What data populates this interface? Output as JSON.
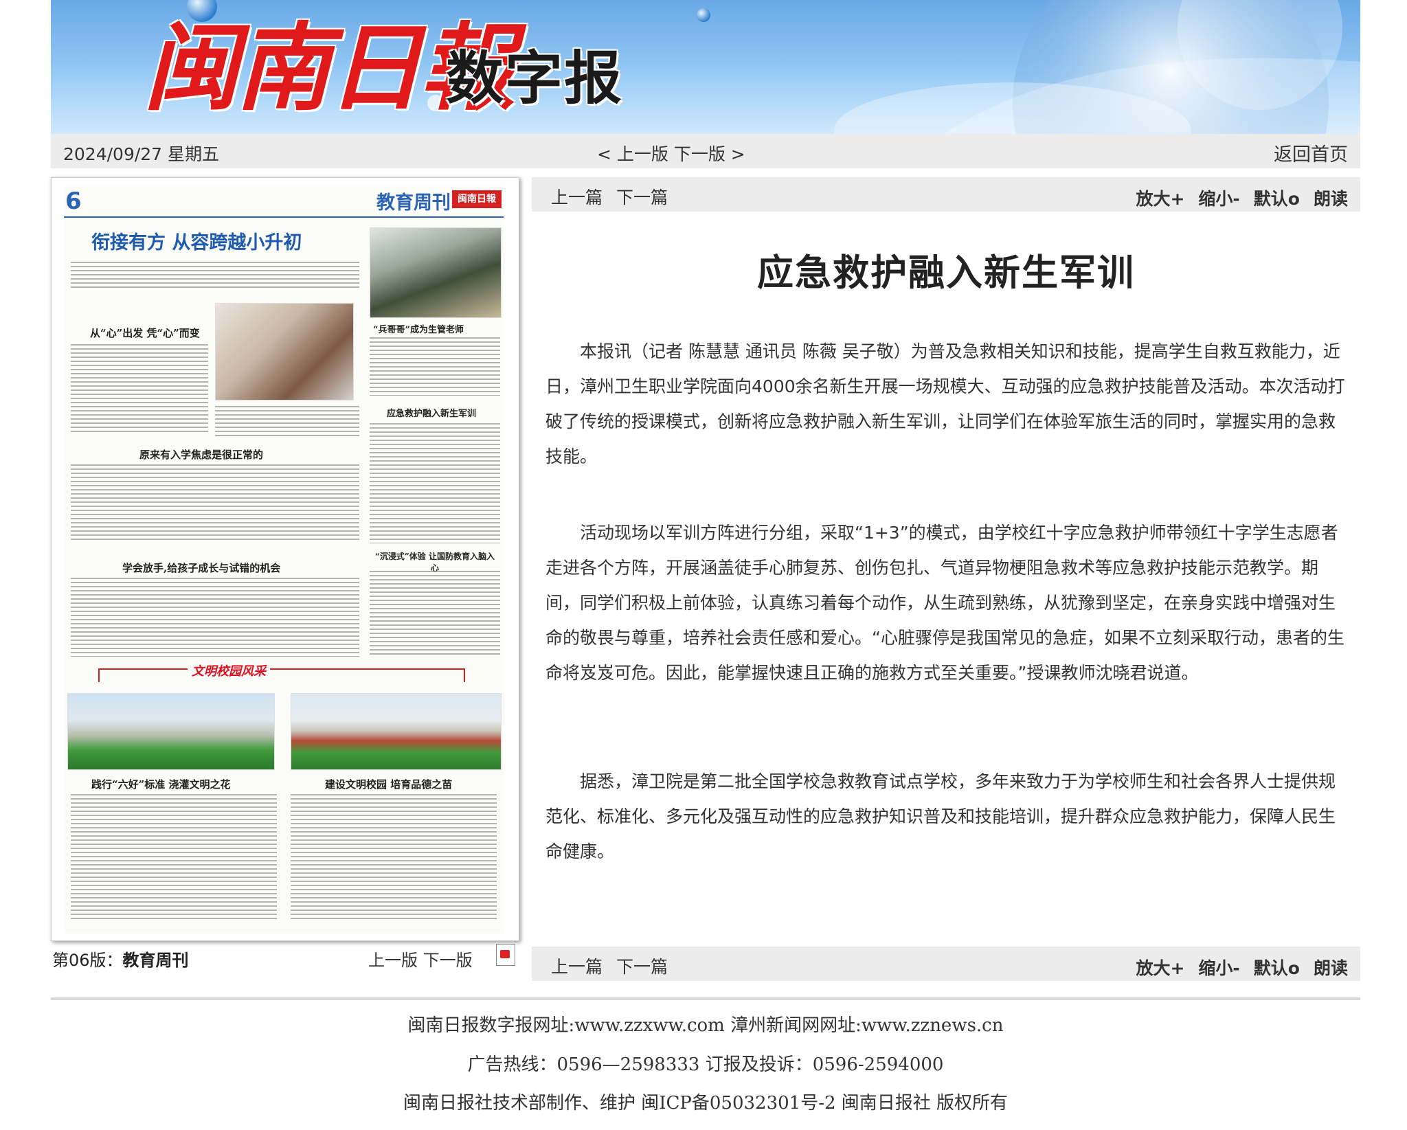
{
  "masthead": {
    "logo_name": "闽南日報",
    "logo_suffix": "数字报"
  },
  "datebar": {
    "date": "2024/09/27 星期五",
    "prev_edition": "< 上一版",
    "next_edition": "下一版 >",
    "home": "返回首页"
  },
  "thumbnail": {
    "page_number": "6",
    "section_title": "教育周刊",
    "logo_small": "闽南日報",
    "headline": "衔接有方 从容跨越小升初",
    "subheads": [
      "从“心”出发 凭“心”而变",
      "原来有入学焦虑是很正常的",
      "学会放手,给孩子成长与试错的机会",
      "“兵哥哥”成为生管老师",
      "应急救护融入新生军训",
      "“沉浸式”体验 让国防教育入脑入心",
      "践行“六好”标准 浇灌文明之花",
      "建设文明校园 培育品德之苗"
    ],
    "banner_text": "文明校园风采",
    "edition_label": "第06版：",
    "edition_name": "教育周刊",
    "prev": "上一版",
    "next": "下一版"
  },
  "article_toolbar": {
    "prev_article": "上一篇",
    "next_article": "下一篇",
    "zoom_in": "放大+",
    "zoom_out": "缩小-",
    "default": "默认o",
    "read_aloud": "朗读"
  },
  "article": {
    "title": "应急救护融入新生军训",
    "paragraphs": [
      "本报讯（记者 陈慧慧 通讯员 陈薇 吴子敬）为普及急救相关知识和技能，提高学生自救互救能力，近日，漳州卫生职业学院面向4000余名新生开展一场规模大、互动强的应急救护技能普及活动。本次活动打破了传统的授课模式，创新将应急救护融入新生军训，让同学们在体验军旅生活的同时，掌握实用的急救技能。",
      "活动现场以军训方阵进行分组，采取“1+3”的模式，由学校红十字应急救护师带领红十字学生志愿者走进各个方阵，开展涵盖徒手心肺复苏、创伤包扎、气道异物梗阻急救术等应急救护技能示范教学。期间，同学们积极上前体验，认真练习着每个动作，从生疏到熟练，从犹豫到坚定，在亲身实践中增强对生命的敬畏与尊重，培养社会责任感和爱心。“心脏骤停是我国常见的急症，如果不立刻采取行动，患者的生命将岌岌可危。因此，能掌握快速且正确的施救方式至关重要。”授课教师沈晓君说道。",
      "据悉，漳卫院是第二批全国学校急救教育试点学校，多年来致力于为学校师生和社会各界人士提供规范化、标准化、多元化及强互动性的应急救护知识普及和技能培训，提升群众应急救护能力，保障人民生命健康。"
    ]
  },
  "footer": {
    "line1": "闽南日报数字报网址:www.zzxww.com 漳州新闻网网址:www.zznews.cn",
    "line2": "广告热线：0596—2598333 订报及投诉：0596-2594000",
    "line3": "闽南日报社技术部制作、维护 闽ICP备05032301号-2 闽南日报社 版权所有"
  }
}
